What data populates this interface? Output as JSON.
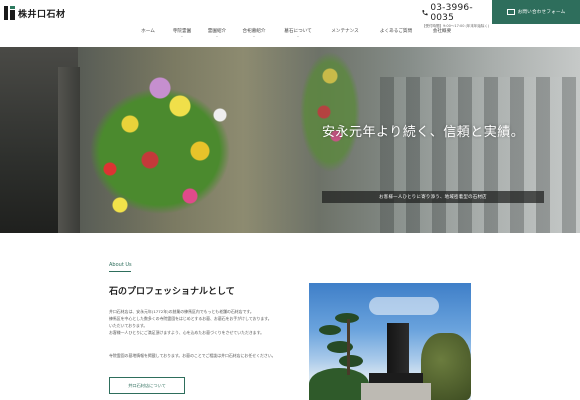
{
  "header": {
    "logo_text": "株井口石材",
    "tel_number": "03-3996-0035",
    "tel_hours": "【受付時間】9:00〜17:00 (年末年始除く)",
    "contact_label": "お問い合わせフォーム",
    "nav": [
      {
        "label": "ホーム",
        "has_dropdown": false
      },
      {
        "label": "寺院霊園",
        "has_dropdown": true
      },
      {
        "label": "霊園紹介",
        "has_dropdown": true
      },
      {
        "label": "合祀墓紹介",
        "has_dropdown": true
      },
      {
        "label": "墓石について",
        "has_dropdown": true
      },
      {
        "label": "メンテナンス",
        "has_dropdown": false
      },
      {
        "label": "よくあるご質問",
        "has_dropdown": false
      },
      {
        "label": "会社概要",
        "has_dropdown": false
      }
    ]
  },
  "hero": {
    "title": "安永元年より続く、信頼と実績。",
    "subtitle": "お客様一人ひとりに寄り添う、地域密着型の石材店"
  },
  "about": {
    "label": "About Us",
    "heading": "石のプロフェッショナルとして",
    "paragraphs": [
      "井口石材店は、安永元年(1772年)の創業の練馬区内でもっとも老舗の石材店です。",
      "練馬区を中心とした数多くの寺院霊園をはじめとするお墓、お墓石をお手がけしております。",
      "いただいております。",
      "お客様一人ひとりにご満足頂けますよう、心を込めたお墓づくりをさせていただきます。",
      "寺院霊園の墓地情報を掲載しております。お墓のことでご相談は井口石材店にお任せください。"
    ],
    "button_label": "井口石材店について"
  },
  "colors": {
    "accent": "#2e6e5c"
  }
}
